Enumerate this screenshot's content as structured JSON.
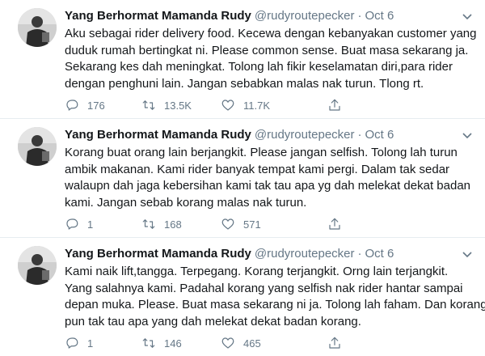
{
  "tweets": [
    {
      "name": "Yang Berhormat Mamanda Rudy",
      "handle": "@rudyroutepecker",
      "dot": "·",
      "date": "Oct 6",
      "lines": [
        "Aku sebagai rider delivery food. Kecewa dengan kebanyakan customer yang",
        "duduk rumah bertingkat ni. Please common sense. Buat masa sekarang ja.",
        "Sekarang kes dah meningkat. Tolong lah fikir keselamatan diri,para rider",
        "dengan penghuni lain. Jangan sebabkan malas nak turun. Tlong rt."
      ],
      "replies": "176",
      "retweets": "13.5K",
      "likes": "11.7K"
    },
    {
      "name": "Yang Berhormat Mamanda Rudy",
      "handle": "@rudyroutepecker",
      "dot": "·",
      "date": "Oct 6",
      "lines": [
        "Korang buat orang lain berjangkit. Please jangan selfish. Tolong lah turun",
        "ambik makanan. Kami rider banyak tempat kami pergi. Dalam tak sedar",
        "walaupn dah jaga kebersihan kami tak tau apa yg dah melekat dekat badan",
        "kami. Jangan sebab korang malas nak turun."
      ],
      "replies": "1",
      "retweets": "168",
      "likes": "571"
    },
    {
      "name": "Yang Berhormat Mamanda Rudy",
      "handle": "@rudyroutepecker",
      "dot": "·",
      "date": "Oct 6",
      "lines": [
        "Kami naik lift,tangga. Terpegang. Korang terjangkit. Orng lain terjangkit.",
        "Yang salahnya kami. Padahal korang yang selfish nak rider hantar sampai",
        "depan muka. Please. Buat masa sekarang ni ja. Tolong lah faham. Dan korang",
        "pun tak tau apa yang dah melekat dekat badan korang."
      ],
      "replies": "1",
      "retweets": "146",
      "likes": "465"
    }
  ],
  "icons": {
    "reply": "reply-icon",
    "retweet": "retweet-icon",
    "like": "heart-icon",
    "share": "share-icon",
    "menu": "chevron-down-icon"
  },
  "colors": {
    "text": "#14171a",
    "secondary": "#657786",
    "divider": "#e6ecf0"
  }
}
